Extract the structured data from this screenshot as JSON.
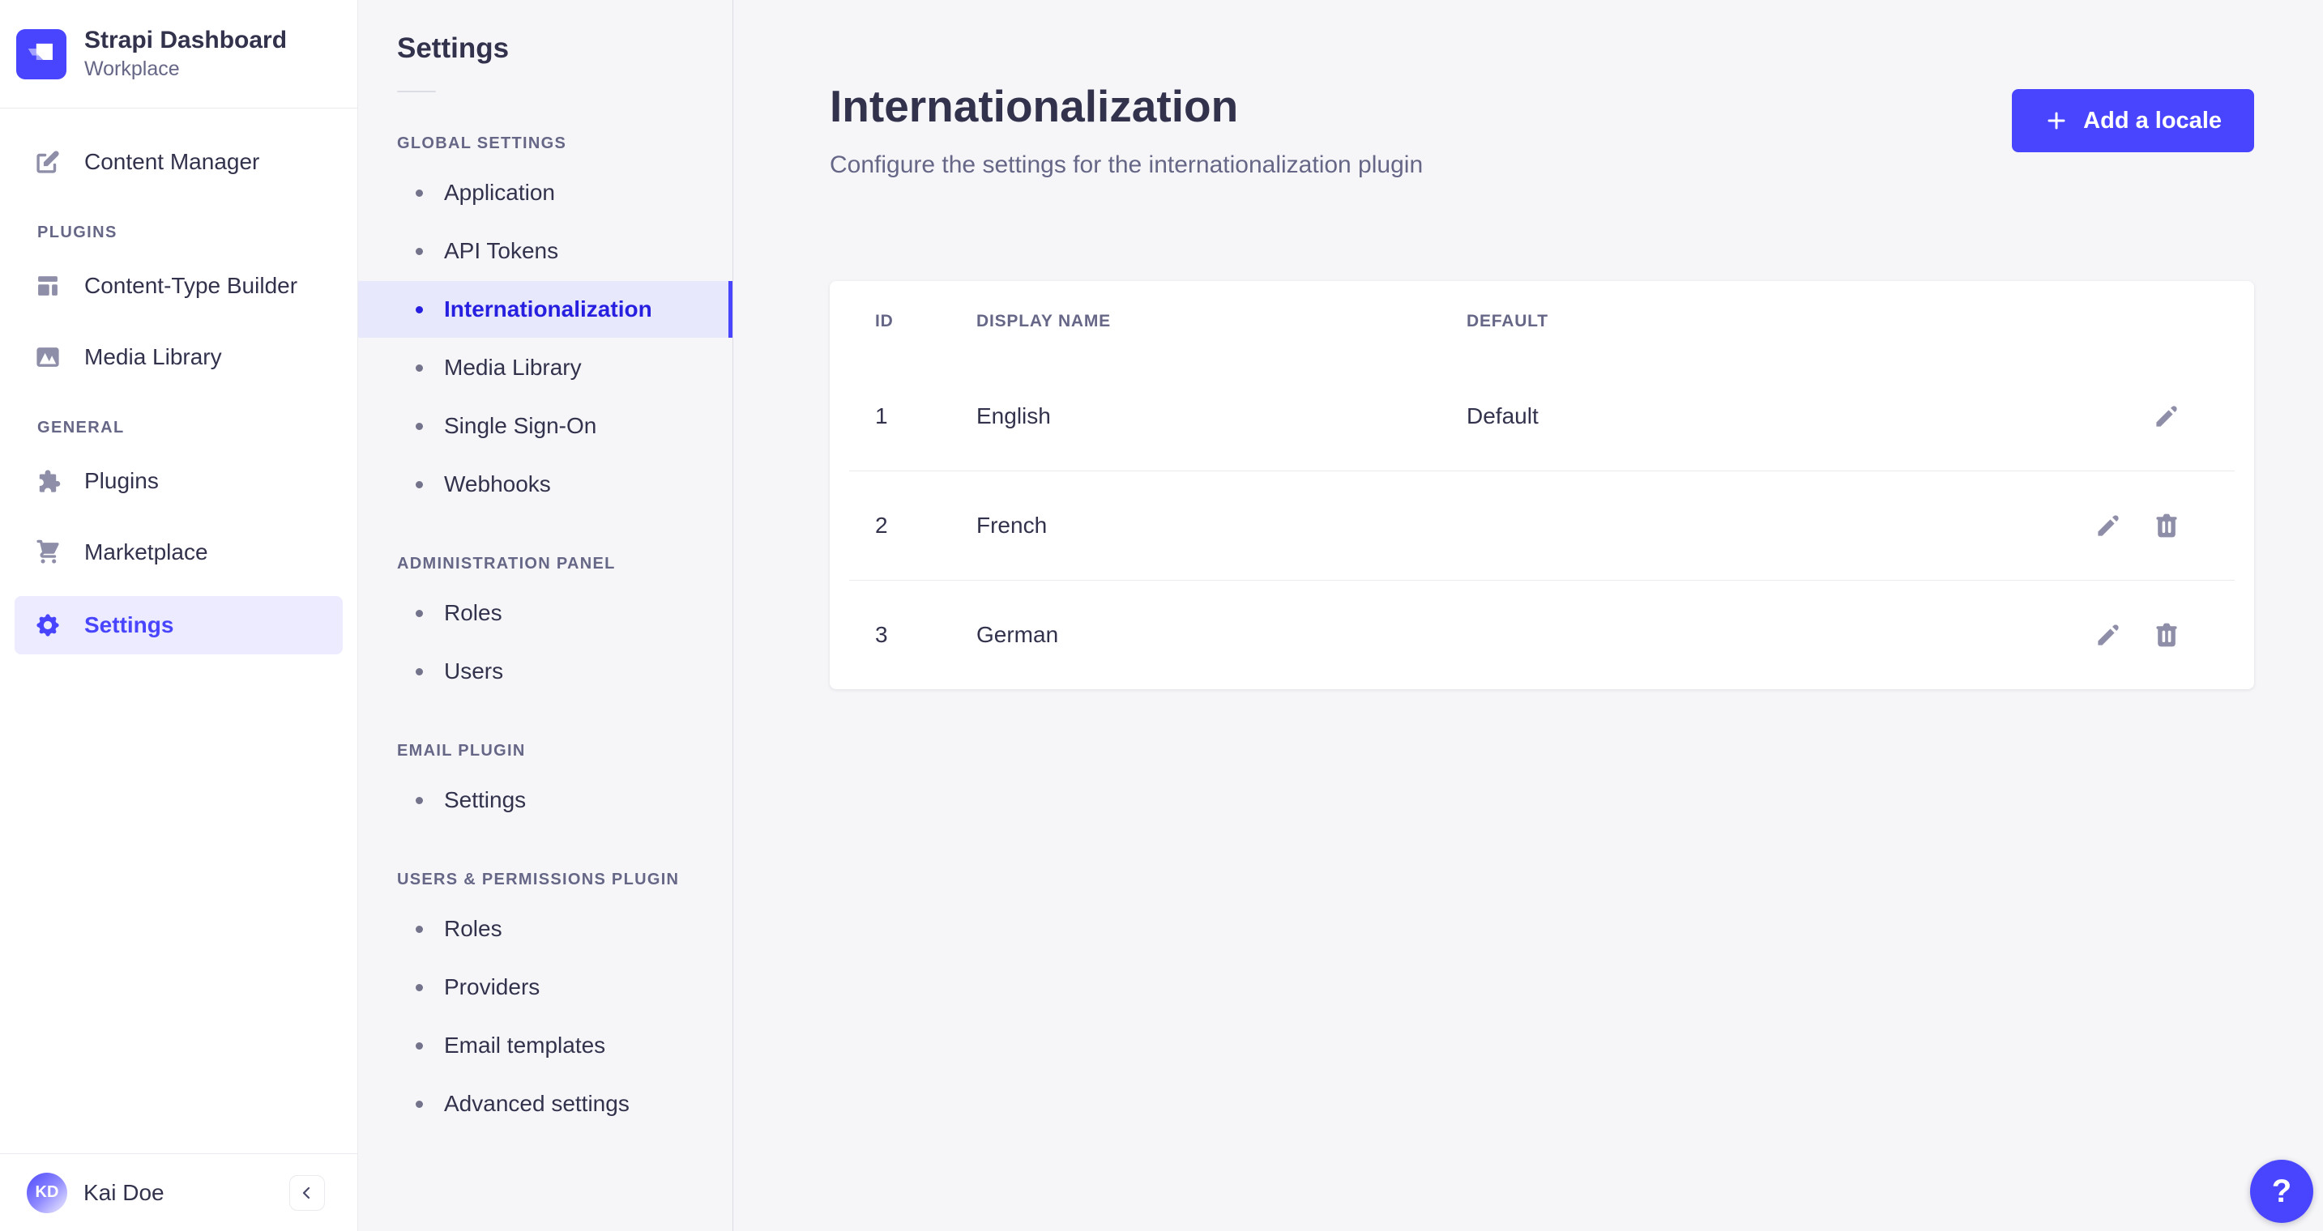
{
  "brand": {
    "title": "Strapi Dashboard",
    "subtitle": "Workplace"
  },
  "sidebar": {
    "primary_item": {
      "label": "Content Manager",
      "icon": "pencil-square-icon"
    },
    "sections": [
      {
        "label": "PLUGINS",
        "items": [
          {
            "label": "Content-Type Builder",
            "icon": "layout-icon",
            "active": false
          },
          {
            "label": "Media Library",
            "icon": "picture-icon",
            "active": false
          }
        ]
      },
      {
        "label": "GENERAL",
        "items": [
          {
            "label": "Plugins",
            "icon": "puzzle-icon",
            "active": false
          },
          {
            "label": "Marketplace",
            "icon": "cart-icon",
            "active": false
          },
          {
            "label": "Settings",
            "icon": "gear-icon",
            "active": true
          }
        ]
      }
    ],
    "footer": {
      "avatar_initials": "KD",
      "user_name": "Kai Doe"
    }
  },
  "subnav": {
    "title": "Settings",
    "groups": [
      {
        "label": "GLOBAL SETTINGS",
        "items": [
          {
            "label": "Application",
            "active": false
          },
          {
            "label": "API Tokens",
            "active": false
          },
          {
            "label": "Internationalization",
            "active": true
          },
          {
            "label": "Media Library",
            "active": false
          },
          {
            "label": "Single Sign-On",
            "active": false
          },
          {
            "label": "Webhooks",
            "active": false
          }
        ]
      },
      {
        "label": "ADMINISTRATION PANEL",
        "items": [
          {
            "label": "Roles",
            "active": false
          },
          {
            "label": "Users",
            "active": false
          }
        ]
      },
      {
        "label": "EMAIL PLUGIN",
        "items": [
          {
            "label": "Settings",
            "active": false
          }
        ]
      },
      {
        "label": "USERS & PERMISSIONS PLUGIN",
        "items": [
          {
            "label": "Roles",
            "active": false
          },
          {
            "label": "Providers",
            "active": false
          },
          {
            "label": "Email templates",
            "active": false
          },
          {
            "label": "Advanced settings",
            "active": false
          }
        ]
      }
    ]
  },
  "main": {
    "title": "Internationalization",
    "subtitle": "Configure the settings for the internationalization plugin",
    "add_button": {
      "label": "Add a locale"
    },
    "table": {
      "columns": [
        "ID",
        "DISPLAY NAME",
        "DEFAULT"
      ],
      "rows": [
        {
          "id": "1",
          "display_name": "English",
          "default": "Default",
          "actions": [
            "edit"
          ]
        },
        {
          "id": "2",
          "display_name": "French",
          "default": "",
          "actions": [
            "edit",
            "delete"
          ]
        },
        {
          "id": "3",
          "display_name": "German",
          "default": "",
          "actions": [
            "edit",
            "delete"
          ]
        }
      ]
    }
  },
  "help": {
    "label": "?"
  },
  "colors": {
    "primary": "#4945ff",
    "primary_dark": "#271fe0",
    "active_bg_sidebar": "#ecebff",
    "active_bg_subnav": "#e8e8fd",
    "text_dark": "#32324d",
    "text_muted": "#666687",
    "icon_gray": "#8e8ea9",
    "border": "#eaeaef",
    "background": "#f6f6f9"
  }
}
